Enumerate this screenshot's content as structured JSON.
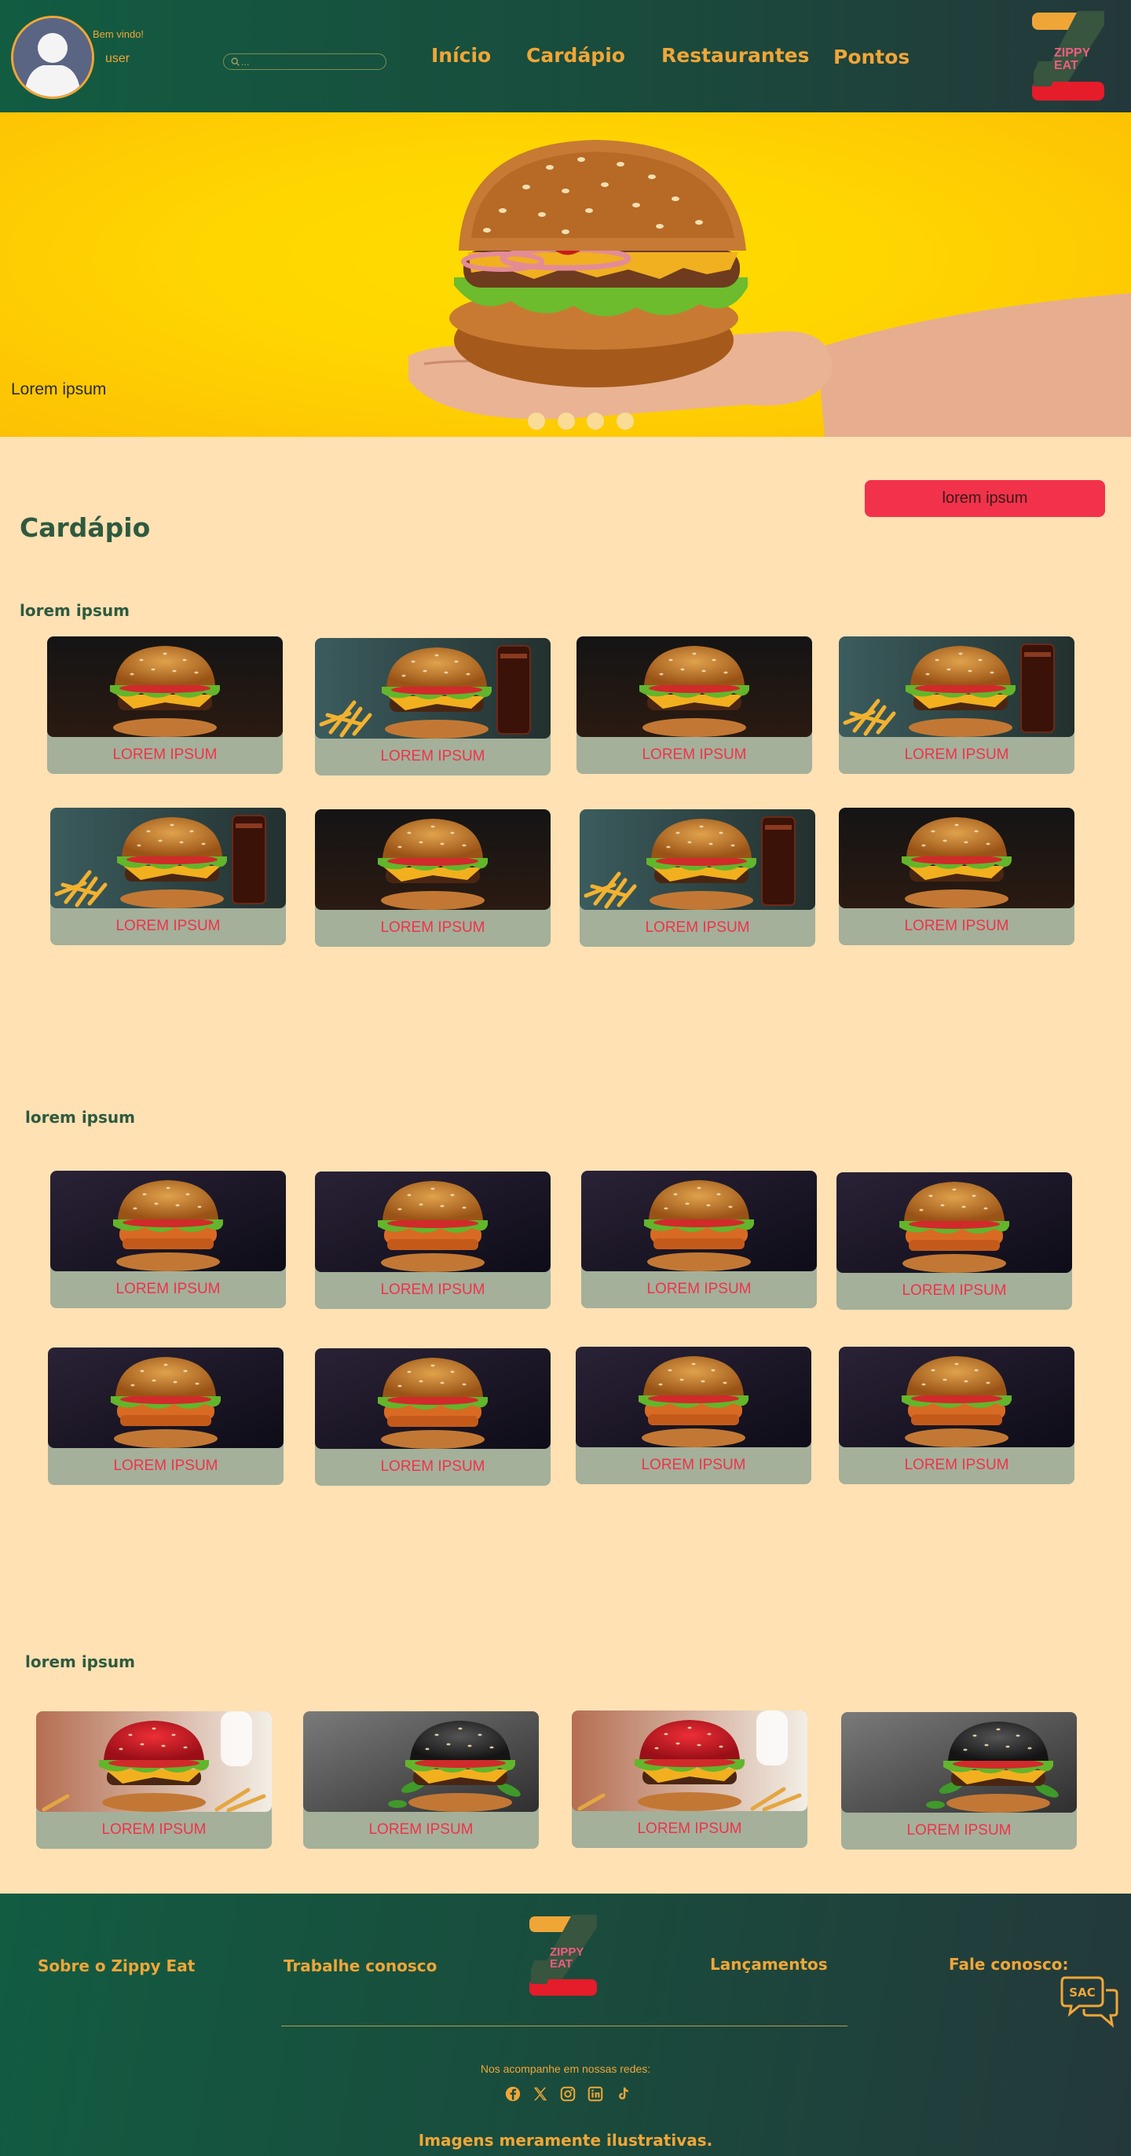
{
  "header": {
    "welcome": "Bem vindo!",
    "username": "user",
    "search_placeholder": "...",
    "nav": [
      "Início",
      "Cardápio",
      "Restaurantes",
      "Pontos"
    ],
    "logo_text": [
      "ZIPPY",
      "EAT"
    ]
  },
  "hero": {
    "caption": "Lorem ipsum",
    "slides": 4
  },
  "menu": {
    "title": "Cardápio",
    "top_button": "lorem ipsum",
    "sections": [
      {
        "title": "lorem ipsum",
        "items": [
          "LOREM IPSUM",
          "LOREM IPSUM",
          "LOREM IPSUM",
          "LOREM IPSUM",
          "LOREM IPSUM",
          "LOREM IPSUM",
          "LOREM IPSUM",
          "LOREM IPSUM"
        ]
      },
      {
        "title": "lorem ipsum",
        "items": [
          "LOREM IPSUM",
          "LOREM IPSUM",
          "LOREM IPSUM",
          "LOREM IPSUM",
          "LOREM IPSUM",
          "LOREM IPSUM",
          "LOREM IPSUM",
          "LOREM IPSUM"
        ]
      },
      {
        "title": "lorem ipsum",
        "items": [
          "LOREM IPSUM",
          "LOREM IPSUM",
          "LOREM IPSUM",
          "LOREM IPSUM"
        ]
      }
    ]
  },
  "footer": {
    "links": [
      "Sobre o Zippy Eat",
      "Trabalhe conosco",
      "Lançamentos",
      "Fale conosco:"
    ],
    "follow_text": "Nos acompanhe em nossas redes:",
    "sac_label": "SAC",
    "socials": [
      "facebook-icon",
      "x-icon",
      "instagram-icon",
      "linkedin-icon",
      "tiktok-icon"
    ],
    "disclaimer": "Imagens meramente ilustrativas."
  },
  "colors": {
    "accent": "#f0a637",
    "brand_green": "#125c42",
    "button_red": "#f1324a",
    "background": "#ffe1b3",
    "card_base": "#a4b09a"
  }
}
